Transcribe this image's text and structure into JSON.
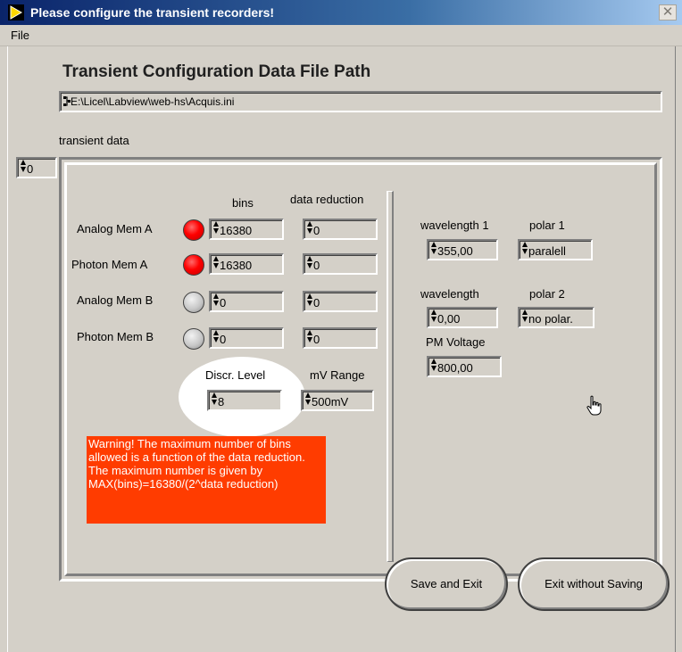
{
  "window": {
    "title": "Please configure the transient recorders!",
    "close_glyph": "✕",
    "menu": [
      "File"
    ]
  },
  "heading": "Transient Configuration Data File Path",
  "file_path": {
    "icon": "path-icon",
    "value": "E:\\Licel\\Labview\\web-hs\\Acquis.ini"
  },
  "transient_data": {
    "label": "transient data",
    "index": "0"
  },
  "columns": {
    "bins": "bins",
    "data_reduction": "data reduction"
  },
  "channels": [
    {
      "label": "Analog Mem A",
      "led": "on",
      "bins": "16380",
      "data_reduction": "0"
    },
    {
      "label": "Photon Mem A",
      "led": "on",
      "bins": "16380",
      "data_reduction": "0"
    },
    {
      "label": "Analog Mem B",
      "led": "off",
      "bins": "0",
      "data_reduction": "0"
    },
    {
      "label": "Photon Mem B",
      "led": "off",
      "bins": "0",
      "data_reduction": "0"
    }
  ],
  "discr": {
    "label": "Discr. Level",
    "value": "8"
  },
  "mv_range": {
    "label": "mV Range",
    "value": "500mV"
  },
  "warning": "Warning! The maximum number of bins allowed is a function of the data reduction.  The maximum number is given by MAX(bins)=16380/(2^data reduction)",
  "right_panel": {
    "wavelength1": {
      "label": "wavelength 1",
      "value": "355,00"
    },
    "polar1": {
      "label": "polar 1",
      "value": "paralell"
    },
    "wavelength2": {
      "label": "wavelength",
      "value": "0,00"
    },
    "polar2": {
      "label": "polar 2",
      "value": "no polar."
    },
    "pm_voltage": {
      "label": "PM Voltage",
      "value": "800,00"
    }
  },
  "buttons": {
    "save": "Save and Exit",
    "exit": "Exit without Saving"
  },
  "colors": {
    "led_on": "#ff0000",
    "led_off": "#c8c8c8",
    "warning_bg": "#ff3c00",
    "titlebar": "#0a246a",
    "panel": "#d4d0c8"
  }
}
